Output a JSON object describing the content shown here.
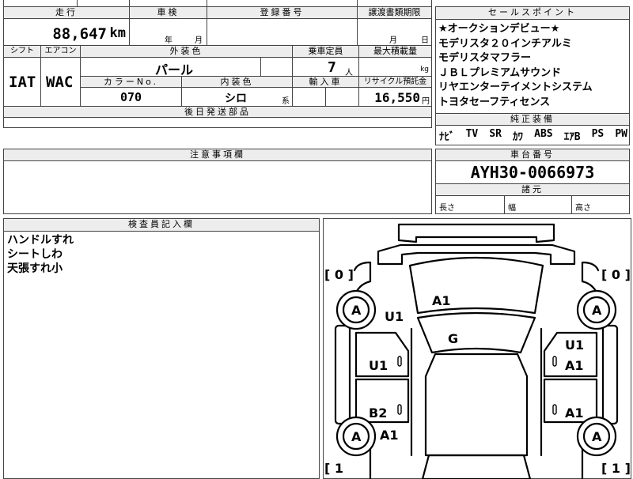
{
  "top_row": {
    "mileage_header": "走行",
    "inspection_header": "車検",
    "registration_header": "登録番号",
    "transfer_deadline_header": "譲渡書類期限",
    "mileage_value": "88,647",
    "mileage_unit": "km",
    "inspection_year_label": "年",
    "inspection_month_label": "月",
    "transfer_month_label": "月",
    "transfer_day_label": "日"
  },
  "second_row": {
    "shift_header": "シフト",
    "ac_header": "エアコン",
    "exterior_color_header": "外装色",
    "capacity_header": "乗車定員",
    "max_load_header": "最大積載量",
    "shift_value": "IAT",
    "ac_value": "WAC",
    "exterior_color_value": "パール",
    "capacity_value": "7",
    "capacity_unit": "人",
    "max_load_unit": "kg",
    "color_no_header": "カラーNo.",
    "interior_color_header": "内装色",
    "import_header": "輸入車",
    "recycle_header": "リサイクル預託金",
    "color_no_value": "070",
    "interior_color_value": "シロ",
    "interior_suffix": "系",
    "recycle_value": "16,550",
    "recycle_unit": "円"
  },
  "later_parts": {
    "header": "後日発送部品"
  },
  "sales_points": {
    "header": "セールスポイント",
    "items": [
      "★オークションデビュー★",
      "モデリスタ２０インチアルミ",
      "モデリスタマフラー",
      "ＪＢＬプレミアムサウンド",
      "リヤエンターテイメントシステム",
      "トヨタセーフティセンス"
    ]
  },
  "equipment": {
    "header": "純正装備",
    "items": [
      "ﾅﾋﾞ",
      "TV",
      "SR",
      "ｶﾜ",
      "ABS",
      "ｴｱB",
      "PS",
      "PW"
    ]
  },
  "notes": {
    "header": "注意事項欄"
  },
  "chassis": {
    "header": "車台番号",
    "value": "AYH30-0066973",
    "dims_header": "諸元",
    "length_label": "長さ",
    "width_label": "幅",
    "height_label": "高さ"
  },
  "inspector": {
    "header": "検査員記入欄",
    "lines": [
      "ハンドルすれ",
      "シートしわ",
      "天張すれ小"
    ]
  },
  "diagram": {
    "tire_left_front": "[ 0 ]",
    "tire_right_front": "[ 0 ]",
    "tire_left_rear": "[ 1",
    "tire_right_rear": "[ 1 ]",
    "wheel_fl": "A",
    "wheel_fr": "A",
    "wheel_rl": "A",
    "wheel_rr": "A",
    "mark_hood": "A1",
    "mark_windshield": "G",
    "mark_left_fender": "U1",
    "mark_left_front_door": "U1",
    "mark_left_rear_door": "B2",
    "mark_left_quarter": "A1",
    "mark_right_fender": "U1",
    "mark_right_front_door": "A1",
    "mark_right_rear_door": "A1"
  }
}
